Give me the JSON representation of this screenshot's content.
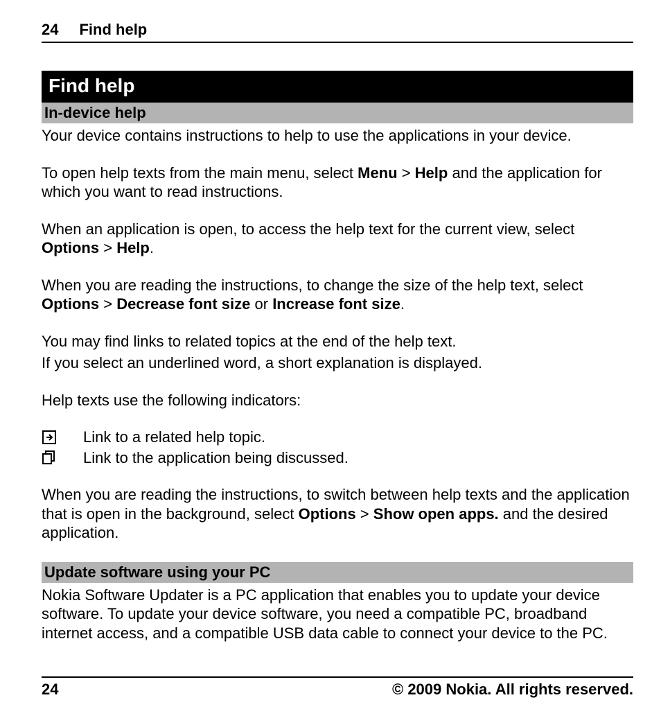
{
  "header": {
    "page_number": "24",
    "section": "Find help"
  },
  "chapter_title": "Find help",
  "section1": {
    "title": "In-device help",
    "p1": "Your device contains instructions to help to use the applications in your device.",
    "p2_a": "To open help texts from the main menu, select ",
    "p2_menu": "Menu",
    "p2_gt1": " > ",
    "p2_help": "Help",
    "p2_b": " and the application for which you want to read instructions.",
    "p3_a": "When an application is open, to access the help text for the current view, select ",
    "p3_options": "Options",
    "p3_gt": " > ",
    "p3_help": "Help",
    "p3_b": ".",
    "p4_a": "When you are reading the instructions, to change the size of the help text, select ",
    "p4_options": "Options",
    "p4_gt": " > ",
    "p4_dec": "Decrease font size",
    "p4_or": " or ",
    "p4_inc": "Increase font size",
    "p4_b": ".",
    "p5": "You may find links to related topics at the end of the help text.",
    "p6": "If you select an underlined word, a short explanation is displayed.",
    "p7": "Help texts use the following indicators:",
    "ind1": "Link to a related help topic.",
    "ind2": "Link to the application being discussed.",
    "p8_a": "When you are reading the instructions, to switch between help texts and the application that is open in the background, select ",
    "p8_options": "Options",
    "p8_gt": " > ",
    "p8_show": "Show open apps.",
    "p8_b": " and the desired application."
  },
  "section2": {
    "title": "Update software using your PC",
    "p1": "Nokia Software Updater is a PC application that enables you to update your device software. To update your device software, you need a compatible PC, broadband internet access, and a compatible USB data cable to connect your device to the PC."
  },
  "footer": {
    "page_number": "24",
    "copyright": "© 2009 Nokia. All rights reserved."
  }
}
